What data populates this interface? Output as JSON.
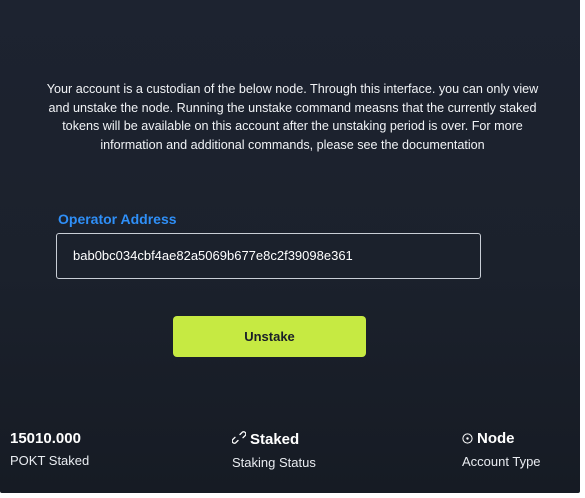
{
  "description": "Your account is a custodian of the below node. Through this interface. you can only view and unstake the node. Running the unstake command measns that the currently staked tokens will be available on this account after the unstaking period is over. For more information and additional commands, please see the documentation",
  "operator": {
    "label": "Operator Address",
    "value": "bab0bc034cbf4ae82a5069b677e8c2f39098e361"
  },
  "unstake_button": {
    "label": "Unstake"
  },
  "stats": {
    "staked": {
      "value": "15010.000",
      "label": "POKT Staked"
    },
    "status": {
      "icon": "link-icon",
      "value": "Staked",
      "label": "Staking Status"
    },
    "account_type": {
      "icon": "circle-dot-icon",
      "value": "Node",
      "label": "Account Type"
    }
  },
  "colors": {
    "background": "#1b212c",
    "accent_blue": "#2f8ff7",
    "button_green": "#c6ea42"
  }
}
